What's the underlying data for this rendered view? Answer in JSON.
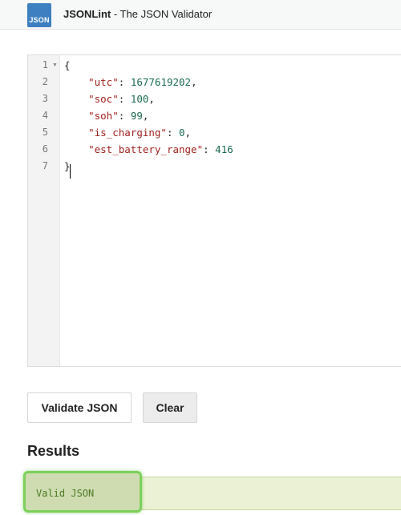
{
  "app": {
    "logo_text": "JSON",
    "brand": "JSONLint",
    "subtitle": " - The JSON Validator"
  },
  "editor": {
    "lines": [
      {
        "num": "1",
        "fold": "▼"
      },
      {
        "num": "2"
      },
      {
        "num": "3"
      },
      {
        "num": "4"
      },
      {
        "num": "5"
      },
      {
        "num": "6"
      },
      {
        "num": "7"
      }
    ],
    "code": {
      "open_brace": "{",
      "close_brace": "}",
      "entries": [
        {
          "key": "\"utc\"",
          "sep": ": ",
          "value": "1677619202",
          "trail": ","
        },
        {
          "key": "\"soc\"",
          "sep": ": ",
          "value": "100",
          "trail": ","
        },
        {
          "key": "\"soh\"",
          "sep": ": ",
          "value": "99",
          "trail": ","
        },
        {
          "key": "\"is_charging\"",
          "sep": ": ",
          "value": "0",
          "trail": ","
        },
        {
          "key": "\"est_battery_range\"",
          "sep": ": ",
          "value": "416",
          "trail": ""
        }
      ]
    }
  },
  "buttons": {
    "validate_label": "Validate JSON",
    "clear_label": "Clear"
  },
  "results": {
    "heading": "Results",
    "status_text": "Valid JSON"
  },
  "colors": {
    "logo_bg": "#3d7fc0",
    "json_string": "#a0231d",
    "json_number": "#1a6b52",
    "result_bg": "#eaf1d4",
    "highlight_border": "#7cd05b",
    "result_text": "#4d7a22"
  }
}
